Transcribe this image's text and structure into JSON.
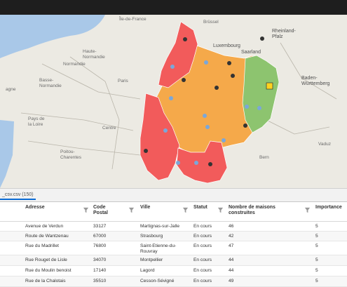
{
  "map": {
    "labels": {
      "ile_de_france": "Île-de-France",
      "haute_normandie": "Haute-\nNormandie",
      "normandie": "Normandie",
      "basse_normandie": "Basse-\nNormandie",
      "paris": "Paris",
      "pays_de_la_loire": "Pays de\nla Loire",
      "centre": "Centre",
      "poitou_charentes": "Poitou-\nCharentes",
      "bretagne": "agne",
      "luxembourg": "Luxembourg",
      "rheinland_pfalz": "Rheinland-\nPfalz",
      "saarland": "Saarland",
      "baden_wurttemberg": "Baden-\nWürttemberg",
      "vaduz": "Vaduz",
      "bern": "Bern",
      "brussel": "Brüssel"
    },
    "colors": {
      "red": "#f25b5b",
      "orange": "#f5a94a",
      "green": "#8dc46f",
      "sea": "#a9c8e8",
      "marker_blue": "#7ba7d9",
      "marker_dark": "#333333"
    }
  },
  "tab": {
    "label": "_csv.csv (150)"
  },
  "table": {
    "columns": [
      "Adresse",
      "Code\nPostal",
      "Ville",
      "Statut",
      "Nombre de maisons\nconstruites",
      "Importance"
    ],
    "rows": [
      [
        "Avenue de Verdun",
        "33127",
        "Martignas-sur-Jalle",
        "En cours",
        "46",
        "5"
      ],
      [
        "Route de Wantzenau",
        "67000",
        "Strasbourg",
        "En cours",
        "42",
        "5"
      ],
      [
        "Rue du Madrillet",
        "76800",
        "Saint-Etienne-du-Rouvray",
        "En cours",
        "47",
        "5"
      ],
      [
        "Rue Rouget de Lisle",
        "34070",
        "Montpellier",
        "En cours",
        "44",
        "5"
      ],
      [
        "Rue du Moulin benoist",
        "17140",
        "Lagord",
        "En cours",
        "44",
        "5"
      ],
      [
        "Rue de la Chalotais",
        "35510",
        "Cesson-Sévigné",
        "En cours",
        "49",
        "5"
      ]
    ]
  }
}
